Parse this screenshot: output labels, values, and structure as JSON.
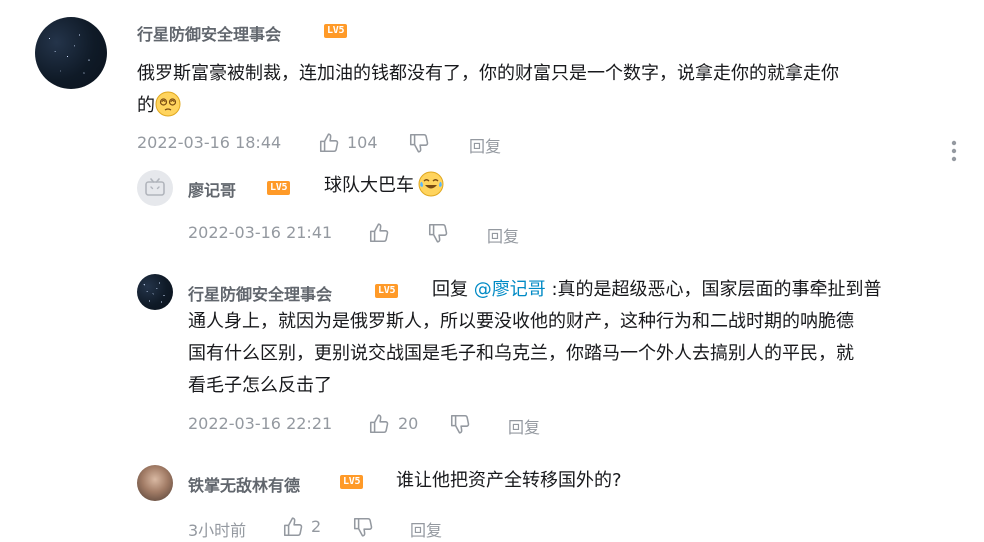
{
  "comments": {
    "main": {
      "username": "行星防御安全理事会",
      "level": "LV5",
      "text_line1": "俄罗斯富豪被制裁，连加油的钱都没有了，你的财富只是一个数字，说拿走你的就拿走你",
      "text_line2": "的",
      "emoji": "dizzy-face",
      "time": "2022-03-16 18:44",
      "likes": "104",
      "reply_label": "回复"
    },
    "reply1": {
      "username": "廖记哥",
      "level": "LV5",
      "text": "球队大巴车",
      "emoji": "laughing-tears",
      "time": "2022-03-16 21:41",
      "reply_label": "回复"
    },
    "reply2": {
      "username": "行星防御安全理事会",
      "level": "LV5",
      "reply_prefix": "回复",
      "mention": "@廖记哥",
      "text_line1": ":真的是超级恶心，国家层面的事牵扯到普",
      "text_line2": "通人身上，就因为是俄罗斯人，所以要没收他的财产，这种行为和二战时期的呐脆德",
      "text_line3": "国有什么区别，更别说交战国是毛子和乌克兰，你踏马一个外人去搞别人的平民，就",
      "text_line4": "看毛子怎么反击了",
      "time": "2022-03-16 22:21",
      "likes": "20",
      "reply_label": "回复"
    },
    "reply3": {
      "username": "铁掌无敌林有德",
      "level": "LV5",
      "text": "谁让他把资产全转移国外的?",
      "time": "3小时前",
      "likes": "2",
      "reply_label": "回复"
    }
  },
  "colors": {
    "username": "#61666d",
    "meta": "#9499a0",
    "mention": "#008ac5",
    "level_badge": "#ff9a28"
  }
}
